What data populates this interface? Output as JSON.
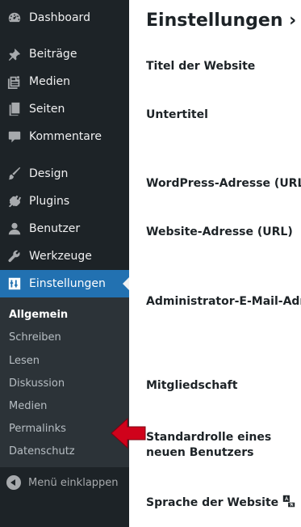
{
  "sidebar": {
    "items": [
      {
        "label": "Dashboard",
        "icon": "dashboard-icon"
      },
      {
        "label": "Beiträge",
        "icon": "pin-icon"
      },
      {
        "label": "Medien",
        "icon": "media-icon"
      },
      {
        "label": "Seiten",
        "icon": "pages-icon"
      },
      {
        "label": "Kommentare",
        "icon": "comment-icon"
      },
      {
        "label": "Design",
        "icon": "brush-icon"
      },
      {
        "label": "Plugins",
        "icon": "plugin-icon"
      },
      {
        "label": "Benutzer",
        "icon": "user-icon"
      },
      {
        "label": "Werkzeuge",
        "icon": "wrench-icon"
      },
      {
        "label": "Einstellungen",
        "icon": "settings-icon"
      }
    ],
    "submenu": [
      "Allgemein",
      "Schreiben",
      "Lesen",
      "Diskussion",
      "Medien",
      "Permalinks",
      "Datenschutz"
    ],
    "collapse_label": "Menü einklappen"
  },
  "main": {
    "title": "Einstellungen › Allg",
    "fields": [
      "Titel der Website",
      "Untertitel",
      "WordPress-Adresse (URL)",
      "Website-Adresse (URL)",
      "Administrator-E-Mail-Adresse",
      "Mitgliedschaft",
      "Standardrolle eines neuen Benutzers",
      "Sprache der Website"
    ]
  },
  "colors": {
    "sidebar_bg": "#1d2327",
    "submenu_bg": "#2c3338",
    "active_bg": "#2271b1",
    "pointer": "#d0021b"
  }
}
